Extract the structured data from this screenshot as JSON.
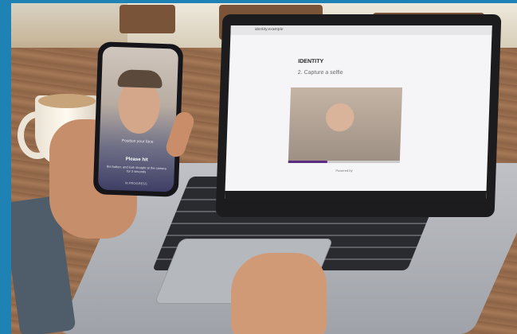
{
  "laptop": {
    "browser_url": "identity.example",
    "brand": "IDENTITY",
    "step_title": "2. Capture a selfie",
    "video_progress_fraction": 0.35,
    "powered_by": "Powered by"
  },
  "phone": {
    "face_caption": "Position your face",
    "heading": "Please hit",
    "subtext": "the button, and look straight at the camera for 3 seconds",
    "footer": "IN PROGRESS"
  },
  "colors": {
    "frame_accent": "#1f82b5",
    "progress": "#5a2d82"
  }
}
